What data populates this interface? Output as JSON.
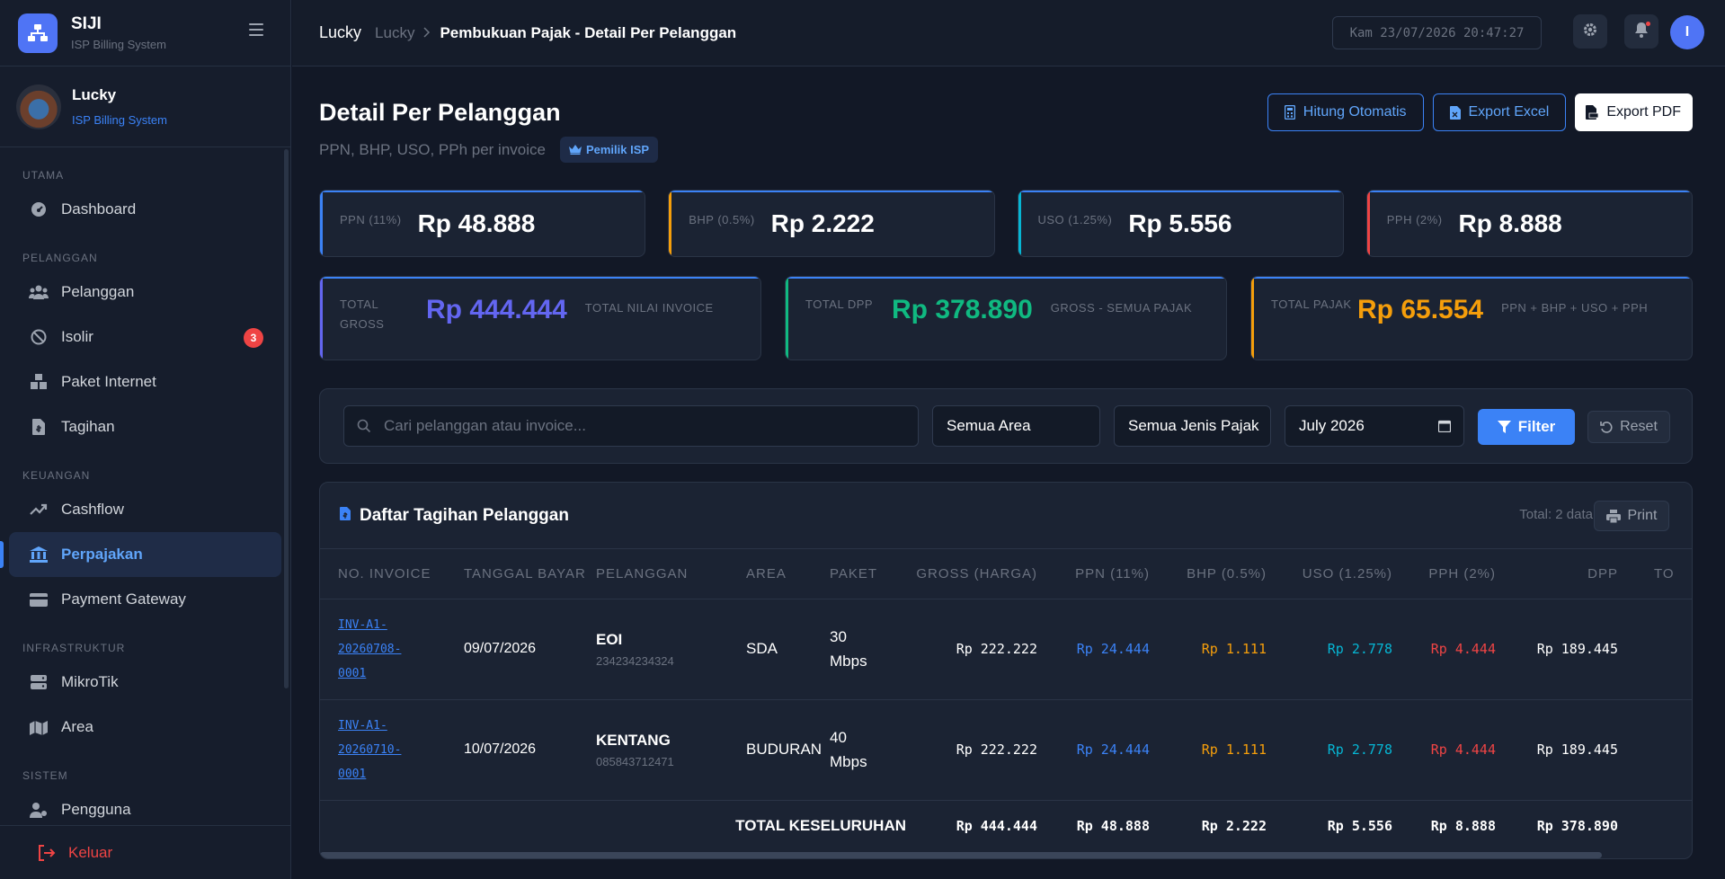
{
  "app": {
    "name": "SIJI",
    "subtitle": "ISP Billing System"
  },
  "profile": {
    "name": "Lucky",
    "role": "ISP Billing System"
  },
  "sidebar": {
    "sections": [
      {
        "title": "UTAMA",
        "items": [
          {
            "label": "Dashboard",
            "icon": "dashboard-icon"
          }
        ]
      },
      {
        "title": "PELANGGAN",
        "items": [
          {
            "label": "Pelanggan",
            "icon": "users-icon"
          },
          {
            "label": "Isolir",
            "icon": "ban-icon",
            "badge": "3"
          },
          {
            "label": "Paket Internet",
            "icon": "boxes-icon"
          },
          {
            "label": "Tagihan",
            "icon": "invoice-icon"
          }
        ]
      },
      {
        "title": "KEUANGAN",
        "items": [
          {
            "label": "Cashflow",
            "icon": "chart-line-icon"
          },
          {
            "label": "Perpajakan",
            "icon": "bank-icon",
            "active": true
          },
          {
            "label": "Payment Gateway",
            "icon": "credit-card-icon"
          }
        ]
      },
      {
        "title": "INFRASTRUKTUR",
        "items": [
          {
            "label": "MikroTik",
            "icon": "server-icon"
          },
          {
            "label": "Area",
            "icon": "map-icon"
          }
        ]
      },
      {
        "title": "SISTEM",
        "items": [
          {
            "label": "Pengguna",
            "icon": "user-cog-icon"
          }
        ]
      }
    ],
    "logout_label": "Keluar"
  },
  "topbar": {
    "breadcrumb_user": "Lucky",
    "breadcrumb_parent": "Lucky",
    "breadcrumb_current": "Pembukuan Pajak - Detail Per Pelanggan",
    "clock": "Kam 23/07/2026 20:47:27",
    "user_initial": "I"
  },
  "page": {
    "title": "Detail Per Pelanggan",
    "subtitle": "PPN, BHP, USO, PPh per invoice",
    "owner_badge": "Pemilik ISP",
    "actions": {
      "auto_calc": "Hitung Otomatis",
      "export_excel": "Export Excel",
      "export_pdf": "Export PDF"
    }
  },
  "stats": [
    {
      "label": "PPN (11%)",
      "value": "Rp 48.888",
      "color": "#3b82f6"
    },
    {
      "label": "BHP (0.5%)",
      "value": "Rp 2.222",
      "color": "#f59e0b"
    },
    {
      "label": "USO (1.25%)",
      "value": "Rp 5.556",
      "color": "#06b6d4"
    },
    {
      "label": "PPH (2%)",
      "value": "Rp 8.888",
      "color": "#ef4444"
    }
  ],
  "totals": [
    {
      "label": "TOTAL GROSS",
      "value": "Rp 444.444",
      "desc": "TOTAL NILAI INVOICE",
      "color": "#6366f1"
    },
    {
      "label": "TOTAL DPP",
      "value": "Rp 378.890",
      "desc": "GROSS - SEMUA PAJAK",
      "color": "#10b981"
    },
    {
      "label": "TOTAL PAJAK",
      "value": "Rp 65.554",
      "desc": "PPN + BHP + USO + PPH",
      "color": "#f59e0b"
    }
  ],
  "filters": {
    "search_placeholder": "Cari pelanggan atau invoice...",
    "area": "Semua Area",
    "tax_type": "Semua Jenis Pajak",
    "month": "July 2026",
    "filter_label": "Filter",
    "reset_label": "Reset"
  },
  "table": {
    "title": "Daftar Tagihan Pelanggan",
    "total_text": "Total: 2 data",
    "print_label": "Print",
    "columns": [
      "NO. INVOICE",
      "TANGGAL BAYAR",
      "PELANGGAN",
      "AREA",
      "PAKET",
      "GROSS (HARGA)",
      "PPN (11%)",
      "BHP (0.5%)",
      "USO (1.25%)",
      "PPH (2%)",
      "DPP",
      "TO"
    ],
    "rows": [
      {
        "invoice": [
          "INV-A1-",
          "20260708-",
          "0001"
        ],
        "date": "09/07/2026",
        "customer": "EOI",
        "phone": "234234234324",
        "area": "SDA",
        "paket": [
          "30",
          "Mbps"
        ],
        "gross": "Rp 222.222",
        "ppn": "Rp 24.444",
        "bhp": "Rp 1.111",
        "uso": "Rp 2.778",
        "pph": "Rp 4.444",
        "dpp": "Rp 189.445"
      },
      {
        "invoice": [
          "INV-A1-",
          "20260710-",
          "0001"
        ],
        "date": "10/07/2026",
        "customer": "KENTANG",
        "phone": "085843712471",
        "area": "BUDURAN",
        "paket": [
          "40",
          "Mbps"
        ],
        "gross": "Rp 222.222",
        "ppn": "Rp 24.444",
        "bhp": "Rp 1.111",
        "uso": "Rp 2.778",
        "pph": "Rp 4.444",
        "dpp": "Rp 189.445"
      }
    ],
    "total_row": {
      "label": "TOTAL KESELURUHAN",
      "gross": "Rp 444.444",
      "ppn": "Rp 48.888",
      "bhp": "Rp 2.222",
      "uso": "Rp 5.556",
      "pph": "Rp 8.888",
      "dpp": "Rp 378.890"
    }
  }
}
